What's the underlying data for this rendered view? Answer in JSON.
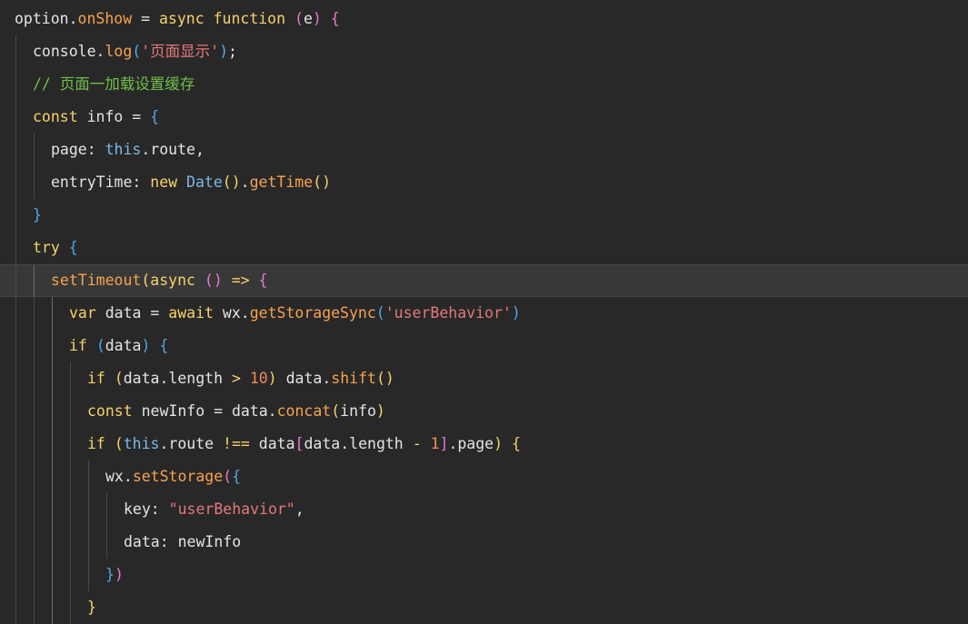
{
  "editor": {
    "current_line": 8,
    "lines": [
      {
        "indent": 0,
        "tokens": [
          {
            "t": "option.",
            "k": "plain"
          },
          {
            "t": "onShow",
            "k": "func"
          },
          {
            "t": " = ",
            "k": "plain"
          },
          {
            "t": "async",
            "k": "keyword"
          },
          {
            "t": " ",
            "k": "plain"
          },
          {
            "t": "function",
            "k": "keyword"
          },
          {
            "t": " ",
            "k": "plain"
          },
          {
            "t": "(",
            "k": "paren"
          },
          {
            "t": "e",
            "k": "plain"
          },
          {
            "t": ")",
            "k": "paren"
          },
          {
            "t": " ",
            "k": "plain"
          },
          {
            "t": "{",
            "k": "paren"
          }
        ]
      },
      {
        "indent": 1,
        "tokens": [
          {
            "t": "console.",
            "k": "plain"
          },
          {
            "t": "log",
            "k": "func"
          },
          {
            "t": "(",
            "k": "bracket"
          },
          {
            "t": "'页面显示'",
            "k": "string"
          },
          {
            "t": ")",
            "k": "bracket"
          },
          {
            "t": ";",
            "k": "plain"
          }
        ]
      },
      {
        "indent": 1,
        "tokens": [
          {
            "t": "// 页面一加载设置缓存",
            "k": "comment"
          }
        ]
      },
      {
        "indent": 1,
        "tokens": [
          {
            "t": "const",
            "k": "keyword"
          },
          {
            "t": " info = ",
            "k": "plain"
          },
          {
            "t": "{",
            "k": "bracket"
          }
        ]
      },
      {
        "indent": 2,
        "tokens": [
          {
            "t": "page: ",
            "k": "plain"
          },
          {
            "t": "this",
            "k": "builtin"
          },
          {
            "t": ".route,",
            "k": "plain"
          }
        ]
      },
      {
        "indent": 2,
        "tokens": [
          {
            "t": "entryTime: ",
            "k": "plain"
          },
          {
            "t": "new",
            "k": "keyword"
          },
          {
            "t": " ",
            "k": "plain"
          },
          {
            "t": "Date",
            "k": "builtin"
          },
          {
            "t": "()",
            "k": "keyword"
          },
          {
            "t": ".",
            "k": "plain"
          },
          {
            "t": "getTime",
            "k": "func"
          },
          {
            "t": "()",
            "k": "keyword"
          }
        ]
      },
      {
        "indent": 1,
        "tokens": [
          {
            "t": "}",
            "k": "bracket"
          }
        ]
      },
      {
        "indent": 1,
        "tokens": [
          {
            "t": "try",
            "k": "keyword"
          },
          {
            "t": " ",
            "k": "plain"
          },
          {
            "t": "{",
            "k": "bracket"
          }
        ]
      },
      {
        "indent": 2,
        "tokens": [
          {
            "t": "setTimeout",
            "k": "func"
          },
          {
            "t": "(",
            "k": "keyword"
          },
          {
            "t": "async",
            "k": "keyword"
          },
          {
            "t": " ",
            "k": "plain"
          },
          {
            "t": "()",
            "k": "paren"
          },
          {
            "t": " => ",
            "k": "keyword"
          },
          {
            "t": "{",
            "k": "paren"
          }
        ]
      },
      {
        "indent": 3,
        "tokens": [
          {
            "t": "var",
            "k": "keyword"
          },
          {
            "t": " data = ",
            "k": "plain"
          },
          {
            "t": "await",
            "k": "keyword"
          },
          {
            "t": " wx.",
            "k": "plain"
          },
          {
            "t": "getStorageSync",
            "k": "func"
          },
          {
            "t": "(",
            "k": "bracket"
          },
          {
            "t": "'userBehavior'",
            "k": "string"
          },
          {
            "t": ")",
            "k": "bracket"
          }
        ]
      },
      {
        "indent": 3,
        "tokens": [
          {
            "t": "if",
            "k": "keyword"
          },
          {
            "t": " ",
            "k": "plain"
          },
          {
            "t": "(",
            "k": "bracket"
          },
          {
            "t": "data",
            "k": "plain"
          },
          {
            "t": ")",
            "k": "bracket"
          },
          {
            "t": " ",
            "k": "plain"
          },
          {
            "t": "{",
            "k": "bracket"
          }
        ]
      },
      {
        "indent": 4,
        "tokens": [
          {
            "t": "if",
            "k": "keyword"
          },
          {
            "t": " ",
            "k": "plain"
          },
          {
            "t": "(",
            "k": "keyword"
          },
          {
            "t": "data.length ",
            "k": "plain"
          },
          {
            "t": ">",
            "k": "keyword"
          },
          {
            "t": " ",
            "k": "plain"
          },
          {
            "t": "10",
            "k": "number"
          },
          {
            "t": ")",
            "k": "keyword"
          },
          {
            "t": " data.",
            "k": "plain"
          },
          {
            "t": "shift",
            "k": "func"
          },
          {
            "t": "()",
            "k": "keyword"
          }
        ]
      },
      {
        "indent": 4,
        "tokens": [
          {
            "t": "const",
            "k": "keyword"
          },
          {
            "t": " newInfo = data.",
            "k": "plain"
          },
          {
            "t": "concat",
            "k": "func"
          },
          {
            "t": "(",
            "k": "keyword"
          },
          {
            "t": "info",
            "k": "plain"
          },
          {
            "t": ")",
            "k": "keyword"
          }
        ]
      },
      {
        "indent": 4,
        "tokens": [
          {
            "t": "if",
            "k": "keyword"
          },
          {
            "t": " ",
            "k": "plain"
          },
          {
            "t": "(",
            "k": "keyword"
          },
          {
            "t": "this",
            "k": "builtin"
          },
          {
            "t": ".route ",
            "k": "plain"
          },
          {
            "t": "!==",
            "k": "keyword"
          },
          {
            "t": " data",
            "k": "plain"
          },
          {
            "t": "[",
            "k": "paren"
          },
          {
            "t": "data.length ",
            "k": "plain"
          },
          {
            "t": "-",
            "k": "keyword"
          },
          {
            "t": " ",
            "k": "plain"
          },
          {
            "t": "1",
            "k": "number"
          },
          {
            "t": "]",
            "k": "paren"
          },
          {
            "t": ".page",
            "k": "plain"
          },
          {
            "t": ")",
            "k": "keyword"
          },
          {
            "t": " ",
            "k": "plain"
          },
          {
            "t": "{",
            "k": "keyword"
          }
        ]
      },
      {
        "indent": 5,
        "tokens": [
          {
            "t": "wx.",
            "k": "plain"
          },
          {
            "t": "setStorage",
            "k": "func"
          },
          {
            "t": "(",
            "k": "paren"
          },
          {
            "t": "{",
            "k": "bracket"
          }
        ]
      },
      {
        "indent": 6,
        "tokens": [
          {
            "t": "key: ",
            "k": "plain"
          },
          {
            "t": "\"userBehavior\"",
            "k": "string"
          },
          {
            "t": ",",
            "k": "plain"
          }
        ]
      },
      {
        "indent": 6,
        "tokens": [
          {
            "t": "data: newInfo",
            "k": "plain"
          }
        ]
      },
      {
        "indent": 5,
        "tokens": [
          {
            "t": "}",
            "k": "bracket"
          },
          {
            "t": ")",
            "k": "paren"
          }
        ]
      },
      {
        "indent": 4,
        "tokens": [
          {
            "t": "}",
            "k": "keyword"
          }
        ]
      }
    ]
  }
}
